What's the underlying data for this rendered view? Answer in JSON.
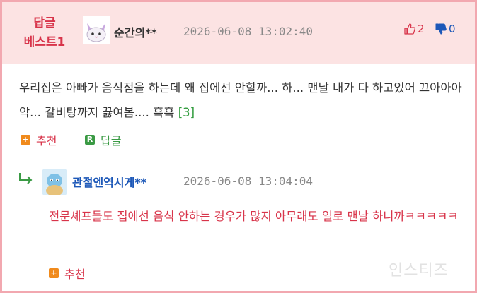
{
  "colors": {
    "frame_border": "#f2a8b0",
    "header_bg": "#fce3e3",
    "accent_red": "#d8344a",
    "accent_blue": "#1d58b8",
    "accent_green": "#3a9a44",
    "accent_orange": "#f08a1c"
  },
  "comment": {
    "badge_line1": "답글",
    "badge_line2": "베스트1",
    "nickname": "순간의**",
    "timestamp": "2026-06-08 13:02:40",
    "upvotes": "2",
    "downvotes": "0",
    "text": "우리집은 아빠가 음식점을 하는데 왜 집에선 안할까... 하... 맨날 내가 다 하고있어 끄아아아악... 갈비탕까지 끓여봄.... 흑흑",
    "reply_count": "[3]",
    "recommend_label": "추천",
    "reply_label": "답글",
    "icons": [
      "thumbs-up-icon",
      "thumbs-down-icon",
      "plus-square-icon",
      "reply-r-icon"
    ]
  },
  "reply": {
    "nickname": "관절엔역시게**",
    "timestamp": "2026-06-08 13:04:04",
    "text": "전문셰프들도 집에선 음식 안하는 경우가 많지 아무래도 일로 맨날 하니까ㅋㅋㅋㅋㅋ",
    "recommend_label": "추천",
    "icons": [
      "reply-arrow-icon",
      "plus-square-icon"
    ]
  },
  "watermark": "인스티즈"
}
